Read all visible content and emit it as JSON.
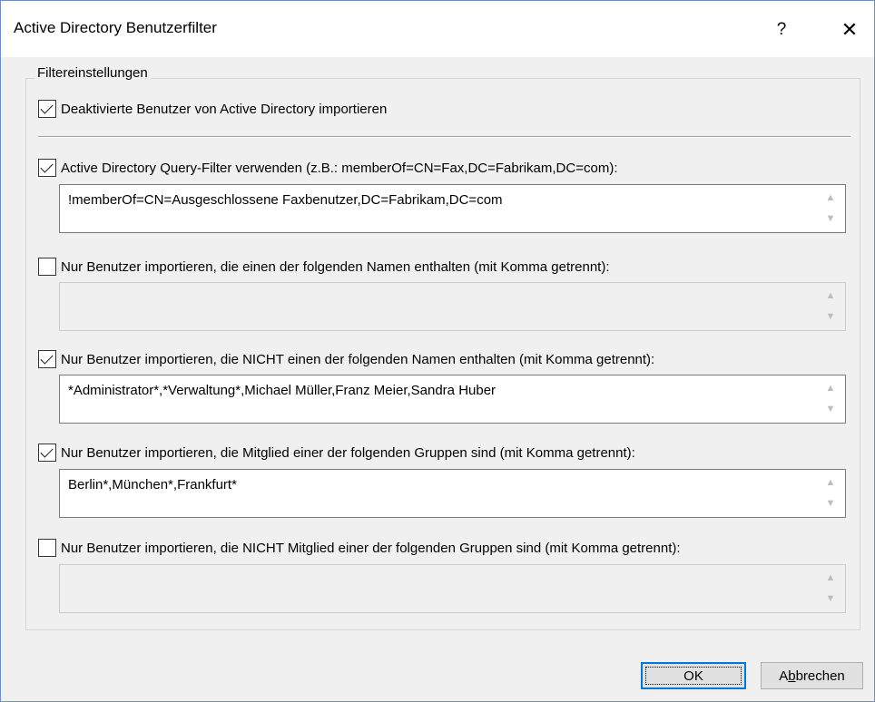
{
  "window": {
    "title": "Active Directory Benutzerfilter",
    "help_label": "?",
    "close_label": "✕"
  },
  "group": {
    "legend": "Filtereinstellungen"
  },
  "options": [
    {
      "label": "Deaktivierte Benutzer von Active Directory importieren",
      "checked": true
    },
    {
      "label": "Active Directory Query-Filter verwenden (z.B.: memberOf=CN=Fax,DC=Fabrikam,DC=com):",
      "checked": true,
      "value": "!memberOf=CN=Ausgeschlossene Faxbenutzer,DC=Fabrikam,DC=com"
    },
    {
      "label": "Nur Benutzer importieren, die einen der folgenden Namen enthalten (mit Komma getrennt):",
      "checked": false,
      "value": ""
    },
    {
      "label": "Nur Benutzer importieren, die NICHT einen der folgenden Namen enthalten (mit Komma getrennt):",
      "checked": true,
      "value": "*Administrator*,*Verwaltung*,Michael Müller,Franz Meier,Sandra Huber"
    },
    {
      "label": "Nur Benutzer importieren, die Mitglied einer der folgenden Gruppen sind (mit Komma getrennt):",
      "checked": true,
      "value": "Berlin*,München*,Frankfurt*"
    },
    {
      "label": "Nur Benutzer importieren, die NICHT Mitglied einer der folgenden Gruppen sind (mit Komma getrennt):",
      "checked": false,
      "value": ""
    }
  ],
  "scroll": {
    "up_icon": "▲",
    "down_icon": "▼"
  },
  "buttons": {
    "ok_label": "OK",
    "cancel_label_prefix": "A",
    "cancel_label_mnemonic": "b",
    "cancel_label_suffix": "brechen"
  },
  "colors": {
    "accent": "#0078d7",
    "background": "#f0f0f0"
  }
}
